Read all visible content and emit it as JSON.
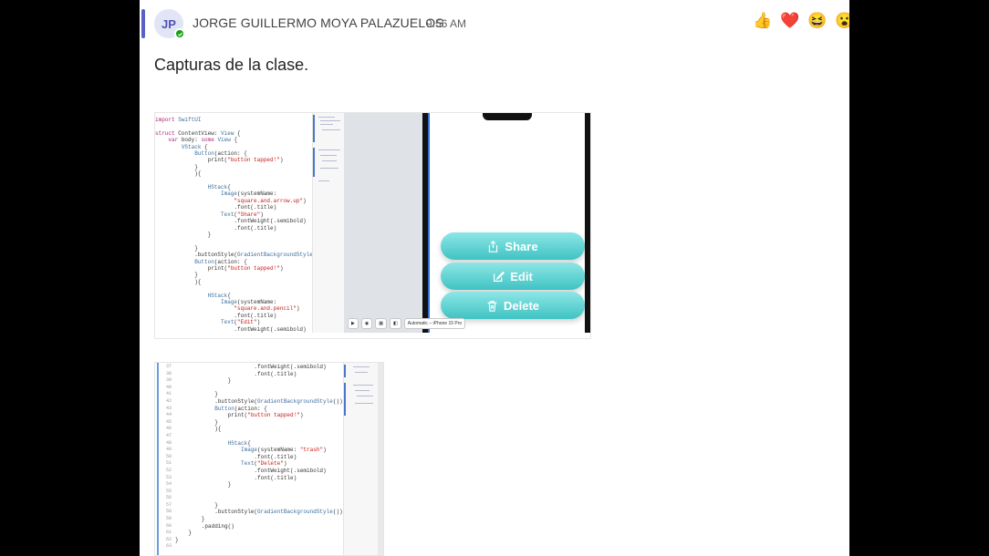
{
  "message": {
    "avatar_initials": "JP",
    "sender": "JORGE GUILLERMO MOYA PALAZUELOS",
    "time": "9:56 AM",
    "text": "Capturas de la clase.",
    "reactions": [
      "👍",
      "❤️",
      "😆",
      "😮"
    ]
  },
  "attachment1": {
    "code_lines": [
      "import SwiftUI",
      "",
      "struct ContentView: View {",
      "    var body: some View {",
      "        VStack {",
      "            Button(action: {",
      "                print(\"button tapped!\")",
      "            }",
      "            ){",
      "",
      "                HStack{",
      "                    Image(systemName:",
      "                        \"square.and.arrow.up\")",
      "                        .font(.title)",
      "                    Text(\"Share\")",
      "                        .fontWeight(.semibold)",
      "                        .font(.title)",
      "                }",
      "",
      "            }",
      "            .buttonStyle(GradientBackgroundStyle())",
      "            Button(action: {",
      "                print(\"button tapped!\")",
      "            }",
      "            ){",
      "",
      "                HStack{",
      "                    Image(systemName:",
      "                        \"square.and.pencil\")",
      "                        .font(.title)",
      "                    Text(\"Edit\")",
      "                        .fontWeight(.semibold)"
    ],
    "preview_buttons": [
      "Share",
      "Edit",
      "Delete"
    ],
    "device_label": "Automatic – iPhone 15 Pro"
  },
  "attachment2": {
    "line_numbers": [
      "37",
      "38",
      "39",
      "40",
      "41",
      "42",
      "43",
      "44",
      "45",
      "46",
      "47",
      "48",
      "49",
      "50",
      "51",
      "52",
      "53",
      "54",
      "55",
      "56",
      "57",
      "58",
      "59",
      "60",
      "61",
      "62",
      "63"
    ],
    "code_lines": [
      "                        .fontWeight(.semibold)",
      "                        .font(.title)",
      "                }",
      "",
      "            }",
      "            .buttonStyle(GradientBackgroundStyle())",
      "            Button(action: {",
      "                print(\"button tapped!\")",
      "            }",
      "            ){",
      "",
      "                HStack{",
      "                    Image(systemName: \"trash\")",
      "                        .font(.title)",
      "                    Text(\"Delete\")",
      "                        .fontWeight(.semibold)",
      "                        .font(.title)",
      "                }",
      "",
      "",
      "            }",
      "            .buttonStyle(GradientBackgroundStyle())",
      "        }",
      "        .padding()",
      "    }",
      "}",
      ""
    ]
  }
}
